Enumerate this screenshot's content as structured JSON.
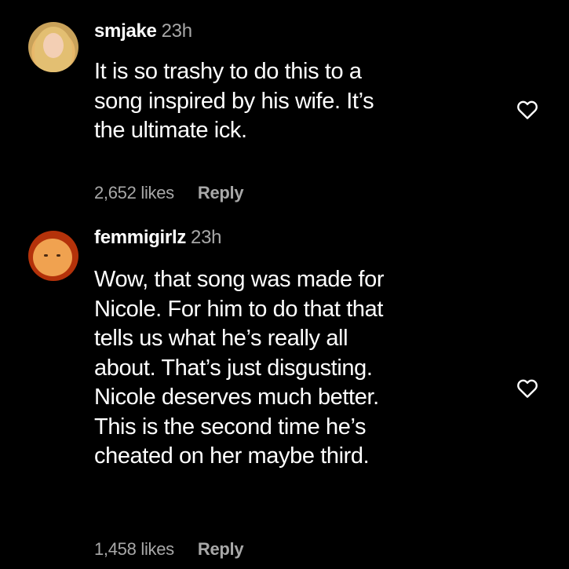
{
  "comments": [
    {
      "username": "smjake",
      "time": "23h",
      "lines": [
        "It is so trashy to do this to a",
        "song inspired by his wife. It’s",
        "the ultimate ick."
      ],
      "likes": "2,652 likes",
      "reply_label": "Reply",
      "avatar_icon": "user-avatar-photo",
      "like_icon": "heart-outline-icon"
    },
    {
      "username": "femmigirlz",
      "time": "23h",
      "lines": [
        "Wow, that song was made for",
        "Nicole. For him to do that that",
        "tells us what he’s really all",
        "about. That’s just disgusting.",
        "Nicole deserves much better.",
        "This is the second time he’s",
        "cheated on her maybe third."
      ],
      "likes": "1,458 likes",
      "reply_label": "Reply",
      "avatar_icon": "user-avatar-photo",
      "like_icon": "heart-outline-icon"
    }
  ],
  "colors": {
    "background": "#000000",
    "text": "#ffffff",
    "muted": "#a8a8a8"
  }
}
